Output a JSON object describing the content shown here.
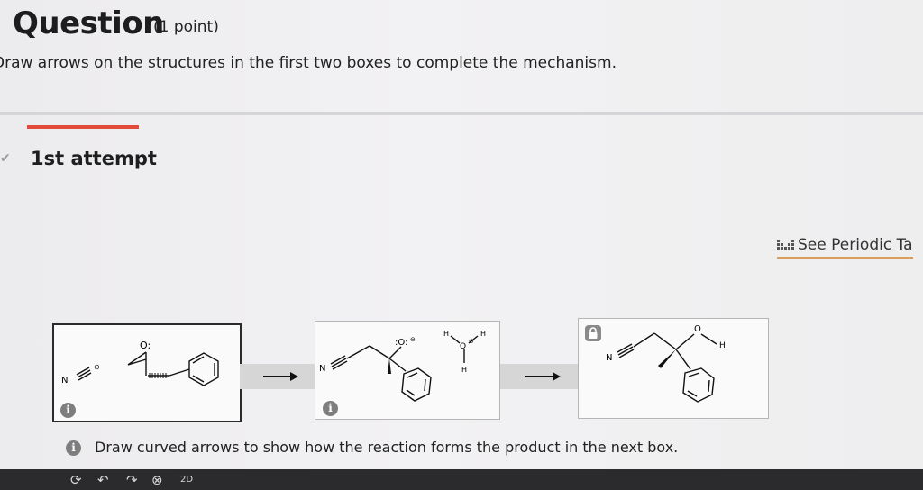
{
  "header": {
    "title": "Question",
    "points": "(1 point)",
    "instructions": "Draw arrows on the structures in the first two boxes to complete the mechanism."
  },
  "attempt": {
    "label": "1st attempt"
  },
  "periodic_table": {
    "label": "See Periodic Ta"
  },
  "hint": {
    "text": "Draw curved arrows to show how the reaction forms the product in the next box."
  },
  "colors": {
    "accent": "#e24a3a",
    "underline": "#d89e5a",
    "toolbar": "#2b2b2e"
  },
  "boxes": [
    {
      "labels": [
        "N",
        "Ö:",
        "⊖"
      ],
      "info_icon": "i"
    },
    {
      "labels": [
        "N",
        ":O:",
        "⊖",
        "H",
        "O",
        "H",
        "⊕",
        "H"
      ],
      "info_icon": "i"
    },
    {
      "labels": [
        "N",
        "O",
        "H"
      ],
      "lock_icon": "lock-icon"
    }
  ],
  "toolbar": {
    "icons": [
      "redo-icon",
      "undo-icon",
      "refresh-icon",
      "clear-icon",
      "2d-icon"
    ],
    "badge_2d": "2D"
  }
}
